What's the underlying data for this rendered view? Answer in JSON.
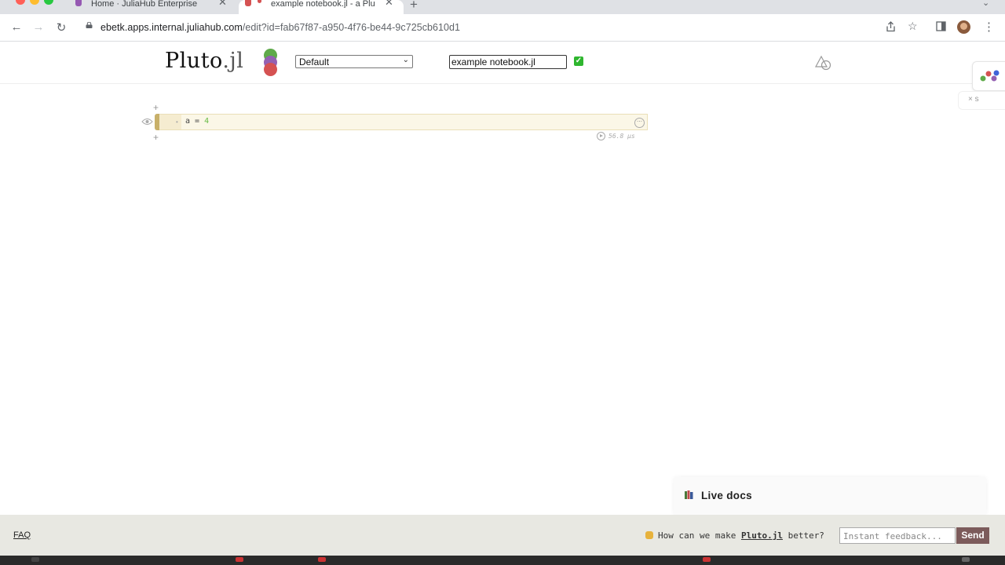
{
  "browser": {
    "tabs": [
      {
        "title": "Home · JuliaHub Enterprise",
        "active": false
      },
      {
        "title": "example notebook.jl - a Plu",
        "active": true
      }
    ],
    "url_main": "ebetk.apps.internal.juliahub.com",
    "url_rest": "/edit?id=fab67f87-a950-4f76-be44-9c725cb610d1"
  },
  "header": {
    "logo_main": "Pluto",
    "logo_suffix": ".jl",
    "environment": "Default",
    "notebook_name": "example notebook.jl",
    "saved_check": "✓"
  },
  "side_widget": {
    "label": "× s"
  },
  "cell": {
    "code_var": "a",
    "code_op": " = ",
    "code_value": "4",
    "runtime": "56.8 μs"
  },
  "live_docs": {
    "title": "Live docs"
  },
  "footer": {
    "faq": "FAQ",
    "question_pre": "How can we make ",
    "question_brand": "Pluto.jl",
    "question_post": " better?",
    "feedback_placeholder": "Instant feedback...",
    "send": "Send"
  },
  "colors": {
    "logo_green": "#5faa4a",
    "logo_purple": "#9460b2",
    "logo_red": "#d55252",
    "cell_bg": "#fbf7e7",
    "footer_bg": "#e8e8e2",
    "send_bg": "#7c5b5b"
  }
}
